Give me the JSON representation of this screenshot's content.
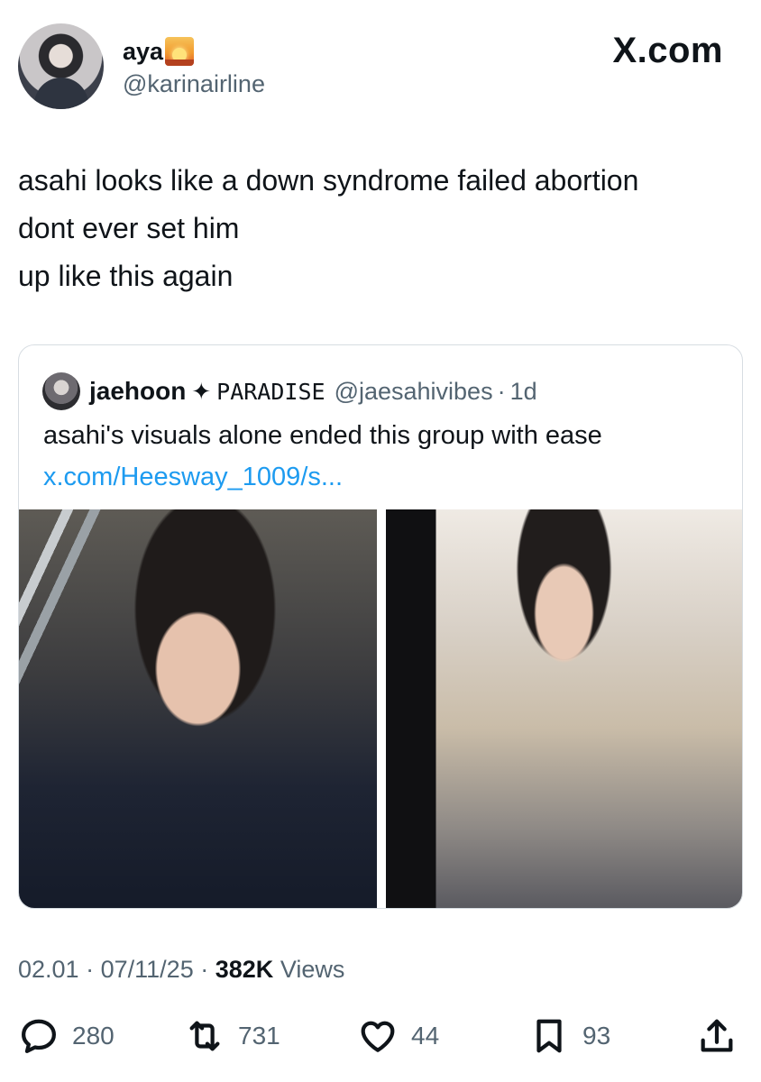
{
  "header": {
    "name": "aya",
    "handle": "@karinairline",
    "brand": "X.com",
    "name_emoji": "sunrise-icon"
  },
  "tweet": {
    "lines": [
      "asahi looks like a down syndrome failed abortion",
      "dont ever set him",
      "up like this again"
    ]
  },
  "quote": {
    "name": "jaehoon",
    "star": "✦",
    "tag": "PARADISE",
    "handle": "@jaesahivibes",
    "separator": "·",
    "time": "1d",
    "text": "asahi's visuals alone ended this group with ease",
    "link": "x.com/Heesway_1009/s..."
  },
  "meta": {
    "time": "02.01",
    "separator": "·",
    "date": "07/11/25",
    "views_count": "382K",
    "views_label": "Views"
  },
  "actions": {
    "replies": "280",
    "reposts": "731",
    "likes": "44",
    "bookmarks": "93"
  },
  "colors": {
    "text": "#0f1419",
    "secondary": "#536471",
    "link": "#1d9bf0",
    "border": "#d7dde2"
  }
}
